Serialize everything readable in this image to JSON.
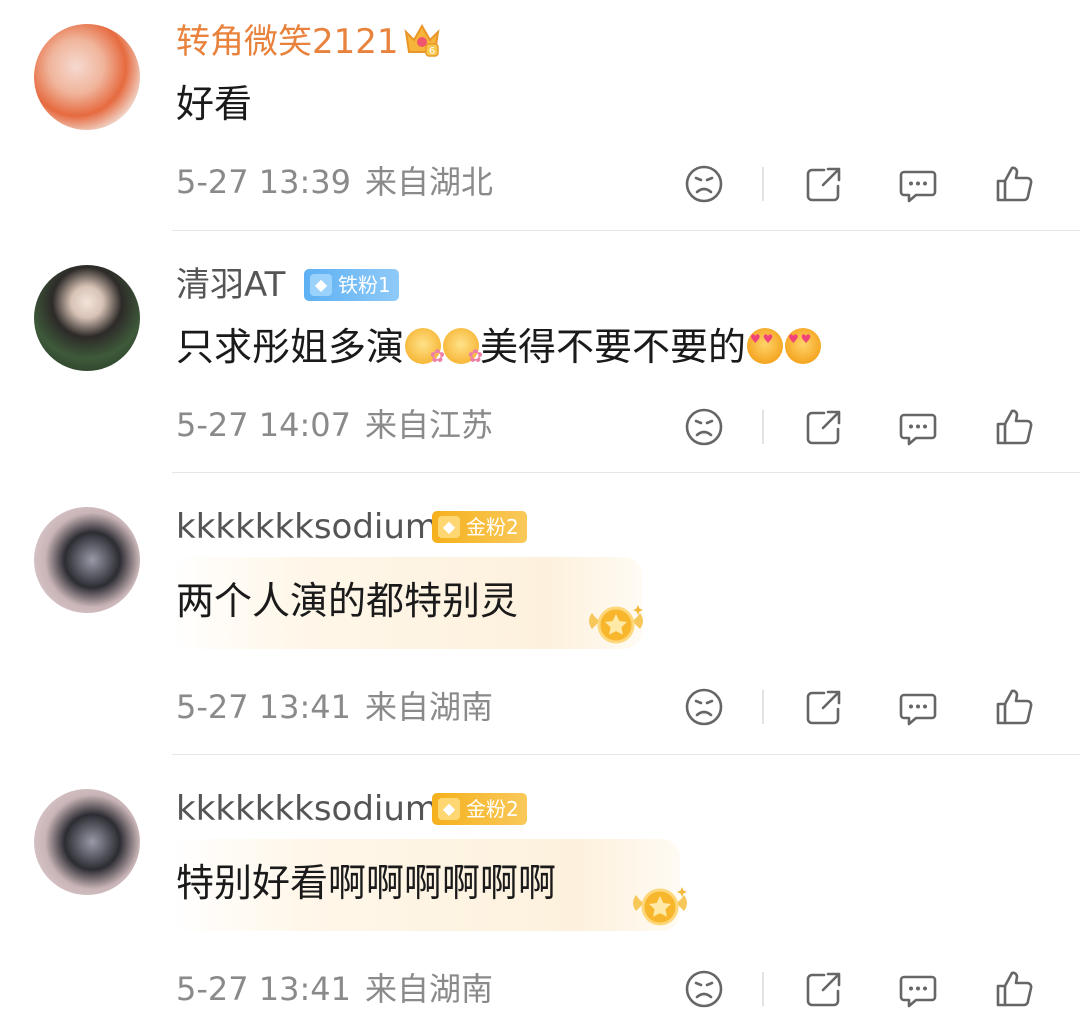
{
  "comments": [
    {
      "username": "转角微笑2121",
      "avatar": "avatar-anime-girl",
      "badge": "crown-icon",
      "content": "好看",
      "date": "5-27 13:39",
      "location": "来自湖北"
    },
    {
      "username": "清羽AT",
      "avatar": "avatar-woman-helmet",
      "badge_label": "铁粉1",
      "content_parts": [
        "只求彤姐多演",
        "美得不要不要的"
      ],
      "emojis": [
        "flower-face-emoji",
        "flower-face-emoji",
        "heart-eyes-emoji",
        "heart-eyes-emoji"
      ],
      "date": "5-27 14:07",
      "location": "来自江苏"
    },
    {
      "username": "kkkkkkksodium",
      "avatar": "avatar-sleeping-person",
      "badge_label": "金粉2",
      "content": "两个人演的都特别灵",
      "date": "5-27 13:41",
      "location": "来自湖南"
    },
    {
      "username": "kkkkkkksodium",
      "avatar": "avatar-sleeping-person",
      "badge_label": "金粉2",
      "content": "特别好看啊啊啊啊啊啊",
      "date": "5-27 13:41",
      "location": "来自湖南"
    }
  ],
  "actions": [
    "dislike-icon",
    "share-icon",
    "comment-icon",
    "like-icon"
  ],
  "colors": {
    "username_orange": "#e8823c",
    "badge_blue": "#5db0f4",
    "badge_gold": "#f5b01c",
    "meta_gray": "#8a8a8a"
  }
}
